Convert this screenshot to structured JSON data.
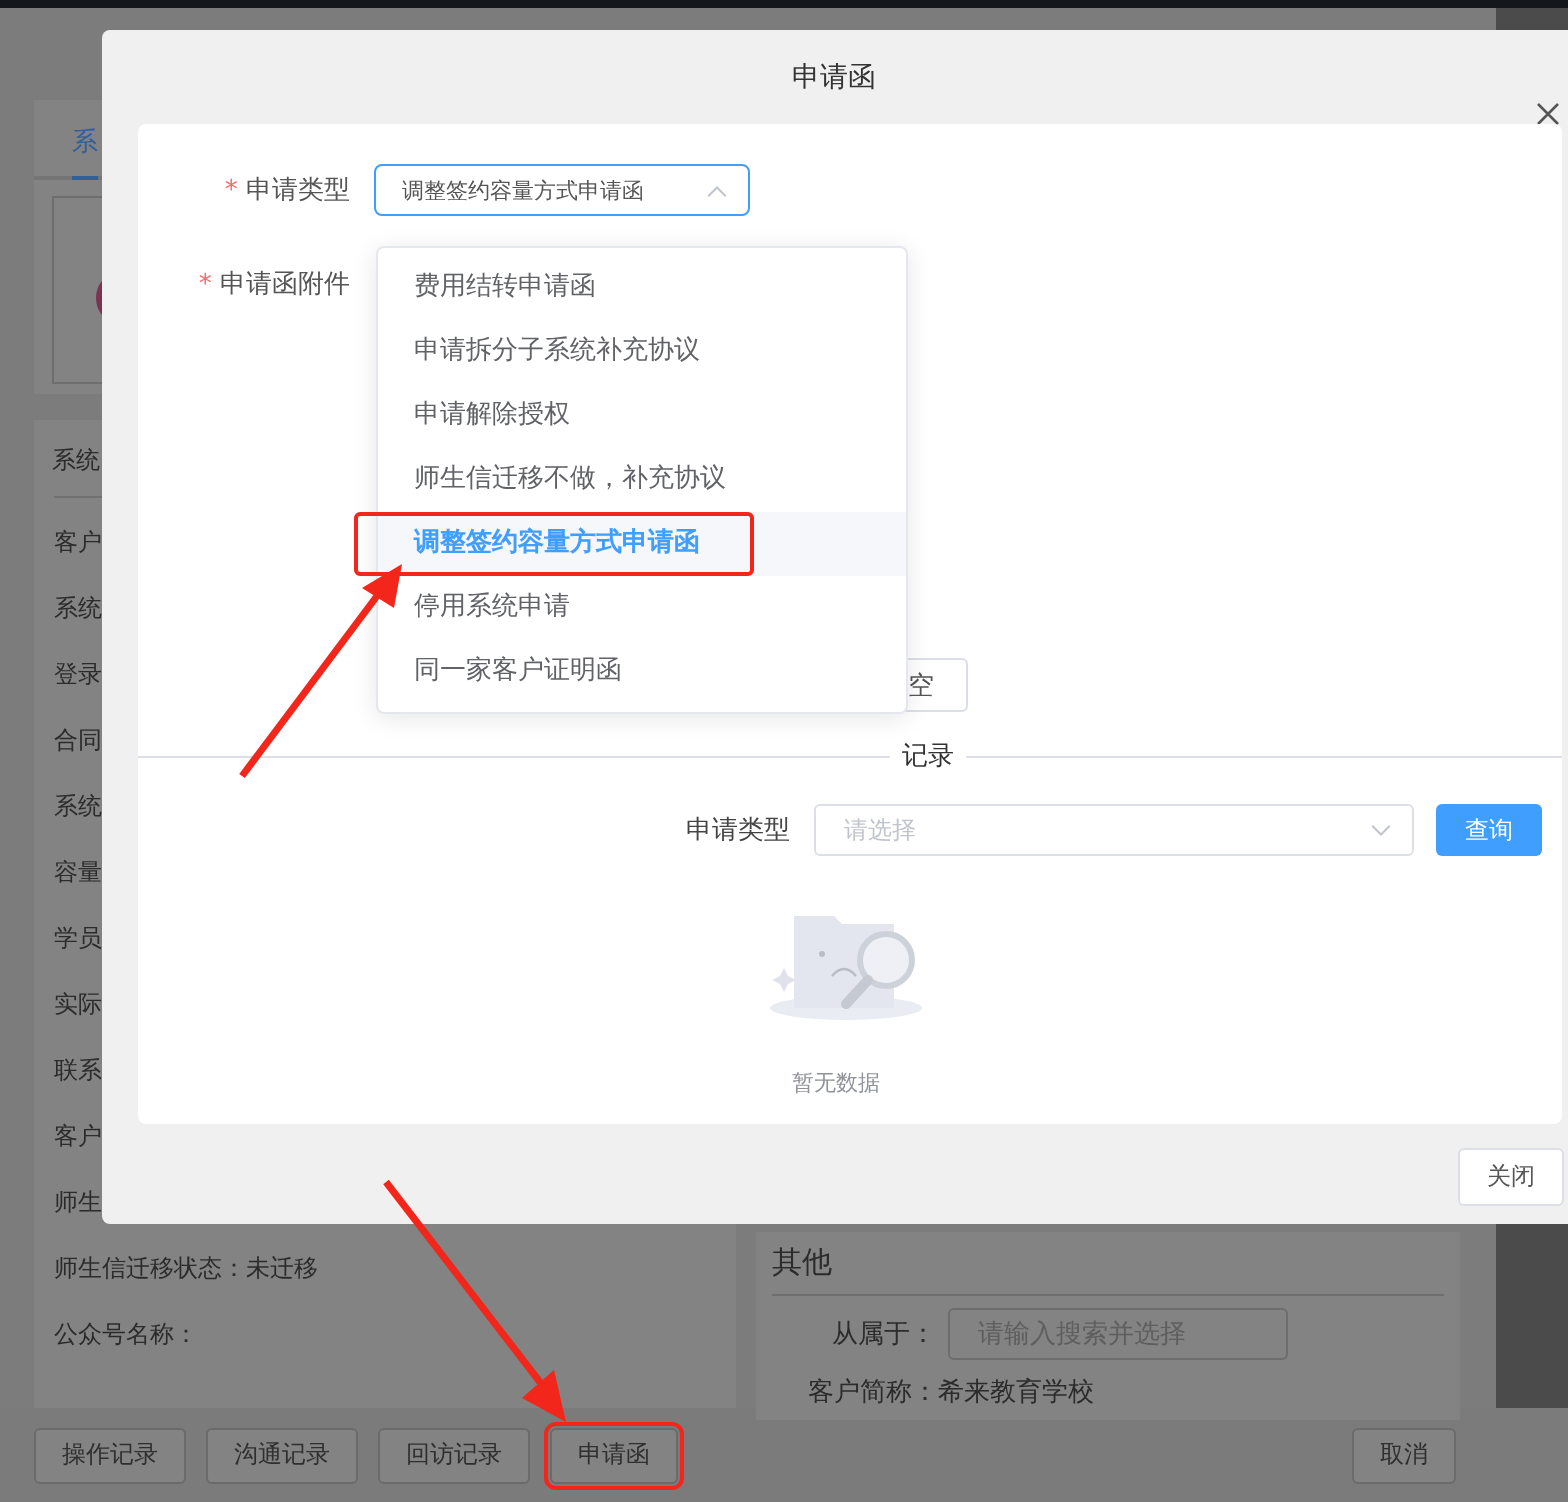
{
  "background": {
    "tab": "系",
    "info_title": "系统",
    "info_rows": [
      "客户",
      "系统",
      "登录",
      "合同",
      "系统",
      "容量",
      "学员",
      "实际",
      "联系",
      "客户",
      "师生",
      "师生信迁移状态：未迁移",
      "公众号名称："
    ],
    "other_title": "其他",
    "other_field": {
      "label": "从属于：",
      "placeholder": "请输入搜索并选择"
    },
    "other_rows": [
      "客户简称：希来教育学校"
    ],
    "footer_buttons": [
      {
        "label": "操作记录",
        "annotated": false
      },
      {
        "label": "沟通记录",
        "annotated": false
      },
      {
        "label": "回访记录",
        "annotated": false
      },
      {
        "label": "申请函",
        "annotated": true
      }
    ],
    "cancel": "取消"
  },
  "dialog": {
    "title": "申请函",
    "form": [
      {
        "mark": "*",
        "label": "申请类型"
      },
      {
        "mark": "*",
        "label": "申请函附件"
      }
    ],
    "select": {
      "value": "调整签约容量方式申请函",
      "expanded": true
    },
    "options": [
      {
        "label": "费用结转申请函",
        "selected": false,
        "annotated": false
      },
      {
        "label": "申请拆分子系统补充协议",
        "selected": false,
        "annotated": false
      },
      {
        "label": "申请解除授权",
        "selected": false,
        "annotated": false
      },
      {
        "label": "师生信迁移不做，补充协议",
        "selected": false,
        "annotated": false
      },
      {
        "label": "调整签约容量方式申请函",
        "selected": true,
        "annotated": true
      },
      {
        "label": "停用系统申请",
        "selected": false,
        "annotated": false
      },
      {
        "label": "同一家客户证明函",
        "selected": false,
        "annotated": false
      }
    ],
    "clear_button": "空",
    "divider": "记录",
    "filter": {
      "label": "申请类型",
      "placeholder": "请选择",
      "button": "查询"
    },
    "empty_text": "暂无数据",
    "close_button": "关闭"
  }
}
